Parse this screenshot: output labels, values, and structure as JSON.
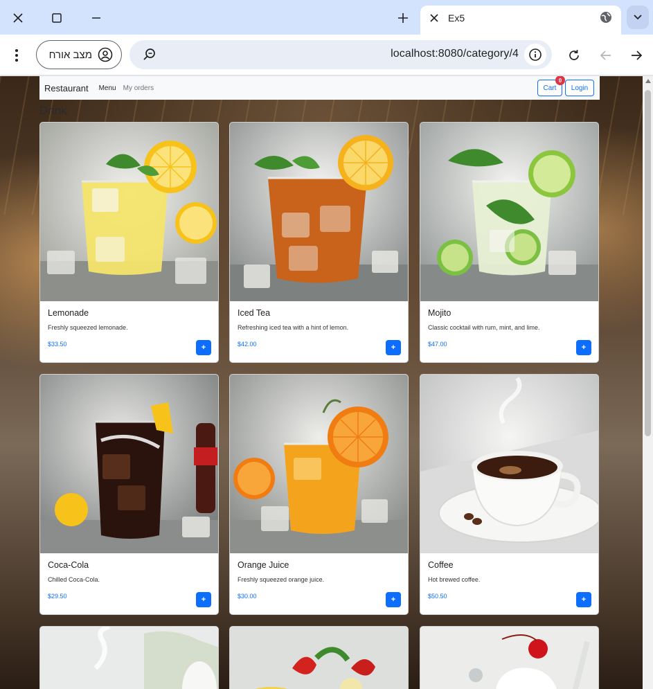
{
  "browser": {
    "tab_title": "Ex5",
    "guest_label": "מצב אורח",
    "url": "localhost:8080/category/4"
  },
  "navbar": {
    "brand": "Restaurant",
    "links": [
      "Menu",
      "My orders"
    ],
    "cart_label": "Cart",
    "cart_count": "0",
    "login_label": "Login"
  },
  "section_title": "Drink",
  "add_label": "+",
  "products": [
    {
      "name": "Lemonade",
      "description": "Freshly squeezed lemonade.",
      "price": "$33.50",
      "icon": "lemonade-image"
    },
    {
      "name": "Iced Tea",
      "description": "Refreshing iced tea with a hint of lemon.",
      "price": "$42.00",
      "icon": "iced-tea-image"
    },
    {
      "name": "Mojito",
      "description": "Classic cocktail with rum, mint, and lime.",
      "price": "$47.00",
      "icon": "mojito-image"
    },
    {
      "name": "Coca-Cola",
      "description": "Chilled Coca-Cola.",
      "price": "$29.50",
      "icon": "coca-cola-image"
    },
    {
      "name": "Orange Juice",
      "description": "Freshly squeezed orange juice.",
      "price": "$30.00",
      "icon": "orange-juice-image"
    },
    {
      "name": "Coffee",
      "description": "Hot brewed coffee.",
      "price": "$50.50",
      "icon": "coffee-image"
    }
  ],
  "colors": {
    "primary": "#0d6efd",
    "badge": "#dc3545",
    "tabbar": "#d3e3fd"
  }
}
